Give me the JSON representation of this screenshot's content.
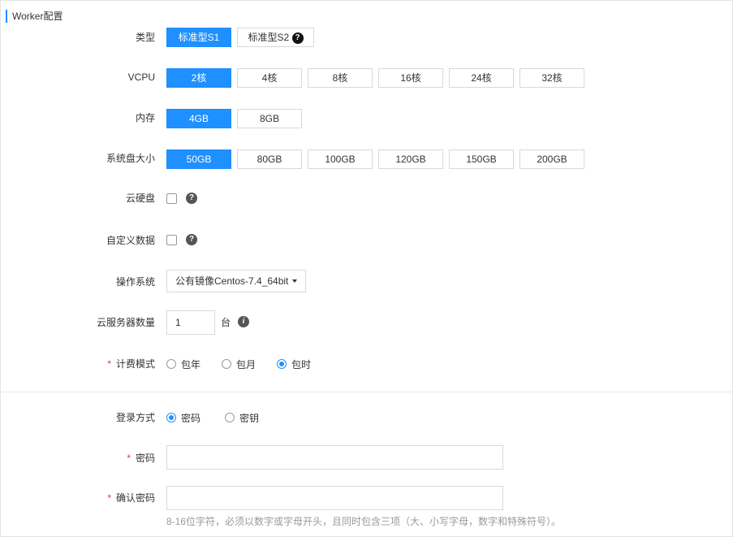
{
  "section": {
    "title": "Worker配置"
  },
  "type": {
    "label": "类型",
    "options": [
      "标准型S1",
      "标准型S2"
    ],
    "selected": 0
  },
  "vcpu": {
    "label": "VCPU",
    "options": [
      "2核",
      "4核",
      "8核",
      "16核",
      "24核",
      "32核"
    ],
    "selected": 0
  },
  "memory": {
    "label": "内存",
    "options": [
      "4GB",
      "8GB"
    ],
    "selected": 0
  },
  "system_disk": {
    "label": "系统盘大小",
    "options": [
      "50GB",
      "80GB",
      "100GB",
      "120GB",
      "150GB",
      "200GB"
    ],
    "selected": 0
  },
  "cloud_disk": {
    "label": "云硬盘",
    "help_icon": "question-icon"
  },
  "custom_data": {
    "label": "自定义数据",
    "help_icon": "question-icon"
  },
  "os": {
    "label": "操作系统",
    "value": "公有镜像Centos-7.4_64bit"
  },
  "server_count": {
    "label": "云服务器数量",
    "value": "1",
    "unit": "台",
    "info_icon": "info-icon"
  },
  "billing": {
    "required": "*",
    "label": "计费模式",
    "options": [
      "包年",
      "包月",
      "包时"
    ],
    "selected": 2
  },
  "login": {
    "label": "登录方式",
    "options": [
      "密码",
      "密钥"
    ],
    "selected": 0
  },
  "password": {
    "required": "*",
    "label": "密码",
    "value": ""
  },
  "confirm_password": {
    "required": "*",
    "label": "确认密码",
    "value": ""
  },
  "hint": "8-16位字符，必须以数字或字母开头，且同时包含三项（大、小写字母，数字和特殊符号）。"
}
